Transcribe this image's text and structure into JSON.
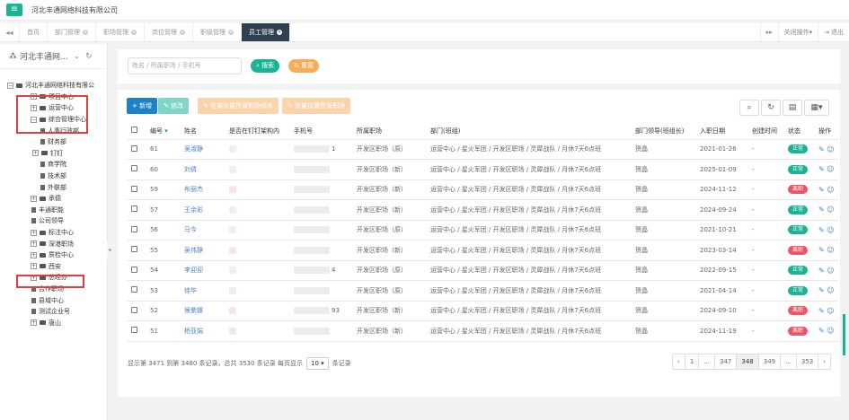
{
  "header": {
    "menu_icon": "hamburger-icon",
    "company": "河北丰通网络科技有限公司"
  },
  "tabs": {
    "nav_back": "◂◂",
    "items": [
      {
        "label": "首页",
        "closable": false
      },
      {
        "label": "部门管理",
        "closable": true
      },
      {
        "label": "职场管理",
        "closable": true
      },
      {
        "label": "岗位管理",
        "closable": true
      },
      {
        "label": "职级管理",
        "closable": true
      },
      {
        "label": "员工管理",
        "closable": true,
        "active": true
      }
    ],
    "nav_forward": "▸▸",
    "close_ops": "关闭操作▾",
    "logout": "退出"
  },
  "sidebar": {
    "org_select": "河北丰通网...",
    "refresh_icon": "refresh-icon",
    "tree": [
      {
        "label": "河北丰通网络科技有限公",
        "level": 0,
        "toggle": "−",
        "type": "folder"
      },
      {
        "label": "项目中心",
        "level": 1,
        "toggle": "+",
        "type": "folder"
      },
      {
        "label": "运营中心",
        "level": 1,
        "toggle": "+",
        "type": "folder"
      },
      {
        "label": "综合管理中心",
        "level": 1,
        "toggle": "−",
        "type": "folder"
      },
      {
        "label": "人事行政部",
        "level": 2,
        "toggle": "",
        "type": "file"
      },
      {
        "label": "财务部",
        "level": 2,
        "toggle": "",
        "type": "file"
      },
      {
        "label": "钉钉",
        "level": 2,
        "toggle": "+",
        "type": "folder"
      },
      {
        "label": "商学院",
        "level": 2,
        "toggle": "",
        "type": "file"
      },
      {
        "label": "技术部",
        "level": 2,
        "toggle": "",
        "type": "file"
      },
      {
        "label": "外联部",
        "level": 2,
        "toggle": "",
        "type": "file"
      },
      {
        "label": "承德",
        "level": 1,
        "toggle": "+",
        "type": "folder"
      },
      {
        "label": "丰通职能",
        "level": 1,
        "toggle": "",
        "type": "file"
      },
      {
        "label": "公司领导",
        "level": 1,
        "toggle": "",
        "type": "file"
      },
      {
        "label": "标注中心",
        "level": 1,
        "toggle": "+",
        "type": "folder"
      },
      {
        "label": "深港职场",
        "level": 1,
        "toggle": "+",
        "type": "folder"
      },
      {
        "label": "质检中心",
        "level": 1,
        "toggle": "+",
        "type": "folder"
      },
      {
        "label": "西安",
        "level": 1,
        "toggle": "+",
        "type": "folder"
      },
      {
        "label": "总经办",
        "level": 1,
        "toggle": "+",
        "type": "folder"
      },
      {
        "label": "合作职场",
        "level": 1,
        "toggle": "",
        "type": "file"
      },
      {
        "label": "县域中心",
        "level": 1,
        "toggle": "",
        "type": "file"
      },
      {
        "label": "测试企业号",
        "level": 1,
        "toggle": "",
        "type": "file"
      },
      {
        "label": "唐山",
        "level": 1,
        "toggle": "+",
        "type": "folder"
      }
    ]
  },
  "search": {
    "placeholder": "姓名 / 所属职场 / 手机号",
    "search_label": "搜索",
    "reset_label": "重置"
  },
  "toolbar": {
    "add": "+ 新增",
    "edit": "修改",
    "batch_leader": "批量设置所属职场组长",
    "batch_workplace": "批量设置所属职场",
    "right_icons": [
      "search-icon",
      "refresh-icon",
      "columns-icon",
      "grid-icon"
    ]
  },
  "table": {
    "headers": [
      "编号",
      "姓名",
      "是否在钉钉架构内",
      "手机号",
      "所属职场",
      "部门(班组)",
      "部门领导(班组长)",
      "入职日期",
      "创建时间",
      "状态",
      "操作"
    ],
    "rows": [
      {
        "id": "61",
        "name": "吴淑静",
        "phone_tail": "1",
        "workplace": "开发区职场（原）",
        "dept": "运营中心 / 星火军团 / 开发区职场 / 灵犀战队 / 月休7天6点班",
        "leader": "贺晶",
        "date": "2021-01-26",
        "created": "-",
        "status": "正常",
        "status_type": "ok"
      },
      {
        "id": "60",
        "name": "刘倩",
        "phone_tail": "",
        "workplace": "开发区职场（新）",
        "dept": "运营中心 / 星火军团 / 开发区职场 / 灵犀战队 / 月休7天6点班",
        "leader": "贺晶",
        "date": "2025-01-09",
        "created": "-",
        "status": "正常",
        "status_type": "ok"
      },
      {
        "id": "59",
        "name": "布丽杰",
        "phone_tail": "",
        "workplace": "开发区职场（新）",
        "dept": "运营中心 / 星火军团 / 开发区职场 / 灵犀战队 / 月休7天6点班",
        "leader": "贺晶",
        "date": "2024-11-12",
        "created": "-",
        "status": "离职",
        "status_type": "off"
      },
      {
        "id": "57",
        "name": "王余彩",
        "phone_tail": "",
        "workplace": "开发区职场（新）",
        "dept": "运营中心 / 星火军团 / 开发区职场 / 灵犀战队 / 月休7天6点班",
        "leader": "贺晶",
        "date": "2024-09-24",
        "created": "-",
        "status": "正常",
        "status_type": "ok"
      },
      {
        "id": "56",
        "name": "马今",
        "phone_tail": "",
        "workplace": "开发区职场（原）",
        "dept": "运营中心 / 星火军团 / 开发区职场 / 灵犀战队 / 月休7天6点班",
        "leader": "贺晶",
        "date": "2021-10-21",
        "created": "-",
        "status": "正常",
        "status_type": "ok"
      },
      {
        "id": "55",
        "name": "吴伟静",
        "phone_tail": "",
        "workplace": "开发区职场（新）",
        "dept": "运营中心 / 星火军团 / 开发区职场 / 灵犀战队 / 月休7天6点班",
        "leader": "贺晶",
        "date": "2023-03-14",
        "created": "-",
        "status": "离职",
        "status_type": "off"
      },
      {
        "id": "54",
        "name": "李迎迎",
        "phone_tail": "4",
        "workplace": "开发区职场（原）",
        "dept": "运营中心 / 星火军团 / 开发区职场 / 灵犀战队 / 月休7天6点班",
        "leader": "贺晶",
        "date": "2022-09-15",
        "created": "-",
        "status": "正常",
        "status_type": "ok"
      },
      {
        "id": "53",
        "name": "徐毕",
        "phone_tail": "",
        "workplace": "开发区职场（原）",
        "dept": "运营中心 / 星火军团 / 开发区职场 / 灵犀战队 / 月休7天6点班",
        "leader": "贺晶",
        "date": "2021-04-14",
        "created": "-",
        "status": "正常",
        "status_type": "ok"
      },
      {
        "id": "52",
        "name": "候紫娜",
        "phone_tail": "93",
        "workplace": "开发区职场（新）",
        "dept": "运营中心 / 星火军团 / 开发区职场 / 灵犀战队 / 月休7天6点班",
        "leader": "贺晶",
        "date": "2024-09-10",
        "created": "-",
        "status": "离职",
        "status_type": "off"
      },
      {
        "id": "51",
        "name": "杨亚娟",
        "phone_tail": "",
        "workplace": "开发区职场（新）",
        "dept": "运营中心 / 星火军团 / 开发区职场 / 灵犀战队 / 月休7天6点班",
        "leader": "贺晶",
        "date": "2024-11-19",
        "created": "-",
        "status": "离职",
        "status_type": "off"
      }
    ]
  },
  "pagination": {
    "summary_prefix": "显示第 3471 到第 3480 条记录，总共 3530 条记录  每页显示",
    "page_size": "10 ▾",
    "summary_suffix": "条记录",
    "pages": [
      "‹",
      "1",
      "...",
      "347",
      "348",
      "349",
      "...",
      "353",
      "›"
    ],
    "active": "348"
  },
  "colors": {
    "accent": "#1ab394",
    "danger": "#ed5565",
    "primary": "#1c84c6",
    "warn": "#f8ac59",
    "dark": "#2f4050"
  }
}
